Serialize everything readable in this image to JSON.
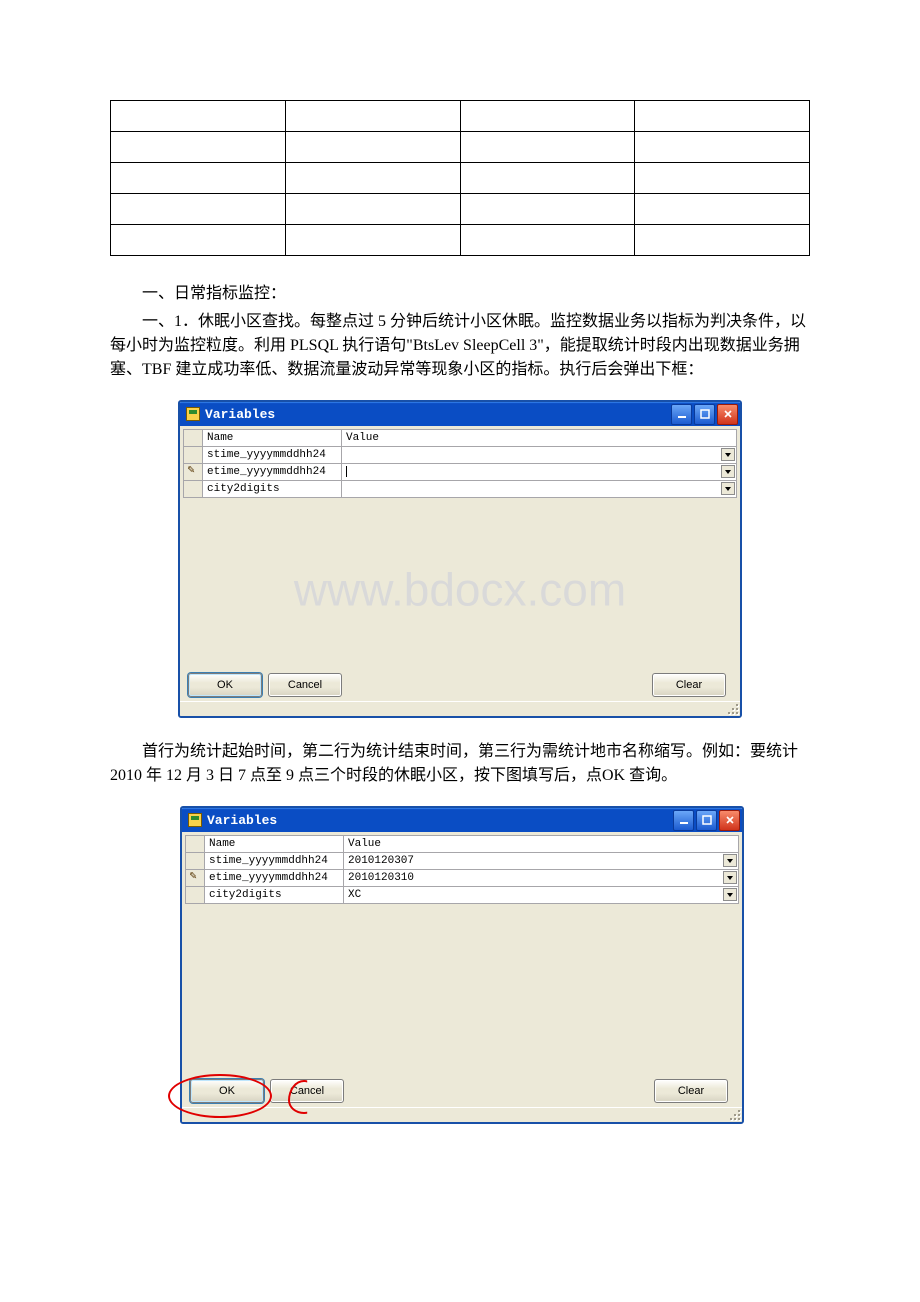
{
  "blank_table": {
    "rows": 5,
    "cols": 4
  },
  "section_heading": "一、日常指标监控：",
  "paragraph_1": "一、1．休眠小区查找。每整点过 5 分钟后统计小区休眠。监控数据业务以指标为判决条件，以每小时为监控粒度。利用 PLSQL 执行语句\"BtsLev SleepCell 3\"，能提取统计时段内出现数据业务拥塞、TBF 建立成功率低、数据流量波动异常等现象小区的指标。执行后会弹出下框：",
  "dialog_title": "Variables",
  "grid_headers": {
    "name": "Name",
    "value": "Value"
  },
  "dialog1": {
    "rows": [
      {
        "name": "stime_yyyymmddhh24",
        "value": ""
      },
      {
        "name": "etime_yyyymmddhh24",
        "value": ""
      },
      {
        "name": "city2digits",
        "value": ""
      }
    ],
    "active_row_index": 1,
    "show_watermark": true
  },
  "watermark_text": "www.bdocx.com",
  "buttons": {
    "ok": "OK",
    "cancel": "Cancel",
    "clear": "Clear"
  },
  "paragraph_2": "首行为统计起始时间，第二行为统计结束时间，第三行为需统计地市名称缩写。例如：要统计 2010 年 12 月 3 日 7 点至 9 点三个时段的休眠小区，按下图填写后，点OK 查询。",
  "dialog2": {
    "rows": [
      {
        "name": "stime_yyyymmddhh24",
        "value": "2010120307"
      },
      {
        "name": "etime_yyyymmddhh24",
        "value": "2010120310"
      },
      {
        "name": "city2digits",
        "value": "XC"
      }
    ],
    "active_row_index": 1,
    "show_watermark": false,
    "annotate_ok": true
  }
}
